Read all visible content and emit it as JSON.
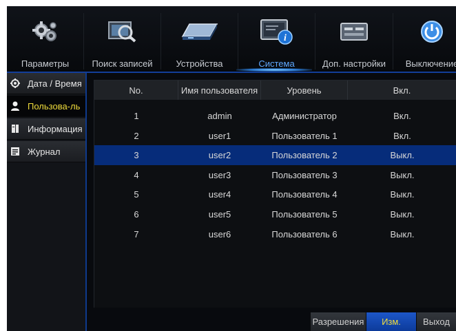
{
  "toolbar": {
    "tabs": [
      {
        "label": "Параметры",
        "icon": "gears-icon"
      },
      {
        "label": "Поиск записей",
        "icon": "film-search-icon"
      },
      {
        "label": "Устройства",
        "icon": "hard-drive-icon"
      },
      {
        "label": "Система",
        "icon": "system-info-icon",
        "active": true
      },
      {
        "label": "Доп. настройки",
        "icon": "advanced-settings-icon"
      },
      {
        "label": "Выключение",
        "icon": "power-icon"
      }
    ]
  },
  "sidebar": {
    "items": [
      {
        "label": "Дата / Время",
        "icon": "gear-clock-icon"
      },
      {
        "label": "Пользова-ль",
        "icon": "user-icon",
        "active": true
      },
      {
        "label": "Информация",
        "icon": "info-book-icon"
      },
      {
        "label": "Журнал",
        "icon": "log-icon"
      }
    ]
  },
  "users_table": {
    "columns": [
      "No.",
      "Имя пользователя",
      "Уровень",
      "Вкл."
    ],
    "rows": [
      {
        "no": "1",
        "name": "admin",
        "level": "Администратор",
        "enabled": "Вкл."
      },
      {
        "no": "2",
        "name": "user1",
        "level": "Пользователь 1",
        "enabled": "Вкл."
      },
      {
        "no": "3",
        "name": "user2",
        "level": "Пользователь 2",
        "enabled": "Выкл.",
        "selected": true
      },
      {
        "no": "4",
        "name": "user3",
        "level": "Пользователь 3",
        "enabled": "Выкл."
      },
      {
        "no": "5",
        "name": "user4",
        "level": "Пользователь 4",
        "enabled": "Выкл."
      },
      {
        "no": "6",
        "name": "user5",
        "level": "Пользователь 5",
        "enabled": "Выкл."
      },
      {
        "no": "7",
        "name": "user6",
        "level": "Пользователь 6",
        "enabled": "Выкл."
      }
    ]
  },
  "buttons": {
    "permissions": "Разрешения",
    "edit": "Изм.",
    "exit": "Выход"
  },
  "colors": {
    "accent_blue": "#062c7a",
    "active_text": "#f0dc3c",
    "active_tab_text": "#5fa8ff"
  }
}
